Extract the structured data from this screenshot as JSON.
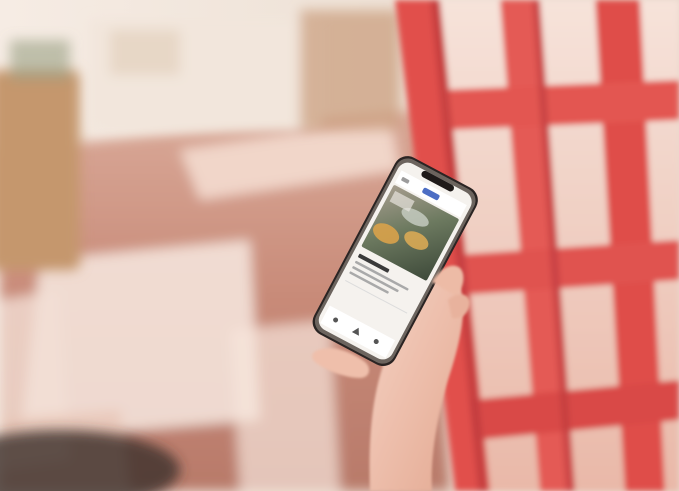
{
  "photo": {
    "subject": "hand-holding-smartphone",
    "colors": {
      "floor": "#c98f7d",
      "floor_light": "#f3e6df",
      "door_frame": "#e3544f",
      "door_frame_dark": "#b8363a",
      "glass": "#f4d8cf",
      "wall": "#efe2d6",
      "planter": "#c99a72",
      "skin": "#f0c4b3",
      "phone_body": "#2a2423",
      "phone_frame": "#e8d8c8",
      "screen_bg": "#f5f2ee",
      "food_photo": "#5b6a55",
      "accent": "#4d6ec4"
    }
  }
}
